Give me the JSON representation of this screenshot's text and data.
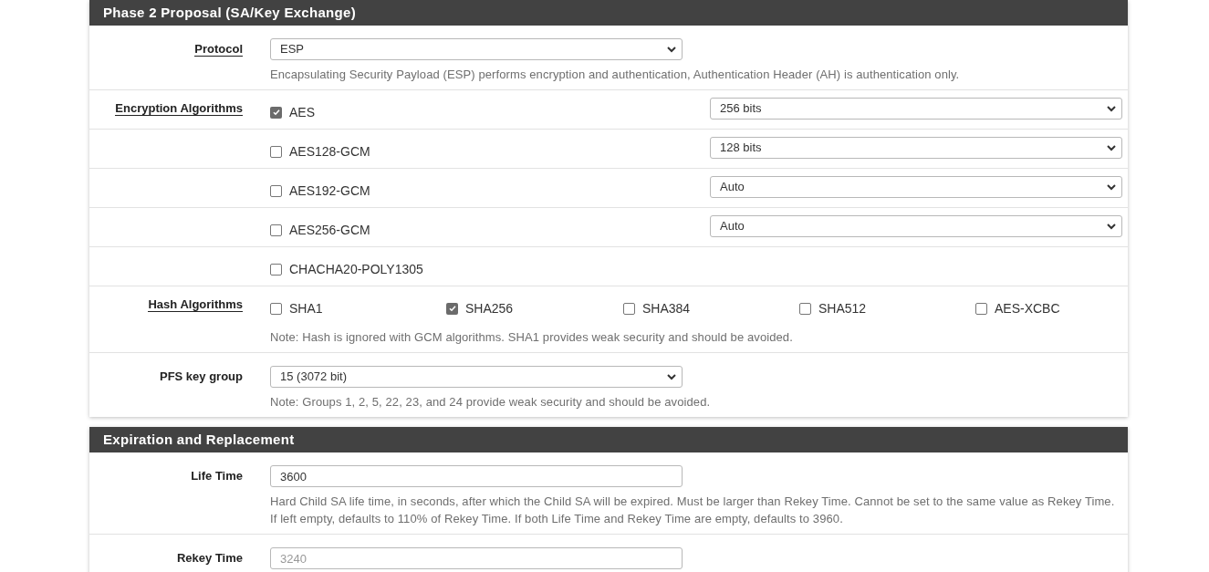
{
  "sections": [
    {
      "title": "Phase 2 Proposal (SA/Key Exchange)",
      "rows": [
        {
          "kind": "select",
          "label": "Protocol",
          "help_link": true,
          "value": "ESP",
          "description": "Encapsulating Security Payload (ESP) performs encryption and authentication, Authentication Header (AH) is authentication only."
        },
        {
          "kind": "checkbox_select",
          "label": "Encryption Algorithms",
          "help_link": true,
          "option": "AES",
          "checked": true,
          "value": "256 bits"
        },
        {
          "kind": "checkbox_select",
          "option": "AES128-GCM",
          "checked": false,
          "value": "128 bits"
        },
        {
          "kind": "checkbox_select",
          "option": "AES192-GCM",
          "checked": false,
          "value": "Auto"
        },
        {
          "kind": "checkbox_select",
          "option": "AES256-GCM",
          "checked": false,
          "value": "Auto"
        },
        {
          "kind": "checkbox",
          "option": "CHACHA20-POLY1305",
          "checked": false
        },
        {
          "kind": "checkboxes",
          "label": "Hash Algorithms",
          "help_link": true,
          "options": [
            {
              "label": "SHA1",
              "checked": false
            },
            {
              "label": "SHA256",
              "checked": true
            },
            {
              "label": "SHA384",
              "checked": false
            },
            {
              "label": "SHA512",
              "checked": false
            },
            {
              "label": "AES-XCBC",
              "checked": false
            }
          ],
          "description": "Note: Hash is ignored with GCM algorithms. SHA1 provides weak security and should be avoided."
        },
        {
          "kind": "select",
          "label": "PFS key group",
          "help_link": false,
          "value": "15 (3072 bit)",
          "description": "Note: Groups 1, 2, 5, 22, 23, and 24 provide weak security and should be avoided."
        }
      ]
    },
    {
      "title": "Expiration and Replacement",
      "rows": [
        {
          "kind": "input",
          "label": "Life Time",
          "help_link": false,
          "value": "3600",
          "description": "Hard Child SA life time, in seconds, after which the Child SA will be expired. Must be larger than Rekey Time. Cannot be set to the same value as Rekey Time. If left empty, defaults to 110% of Rekey Time. If both Life Time and Rekey Time are empty, defaults to 3960."
        },
        {
          "kind": "input",
          "label": "Rekey Time",
          "help_link": false,
          "placeholder": "3240"
        }
      ]
    }
  ]
}
